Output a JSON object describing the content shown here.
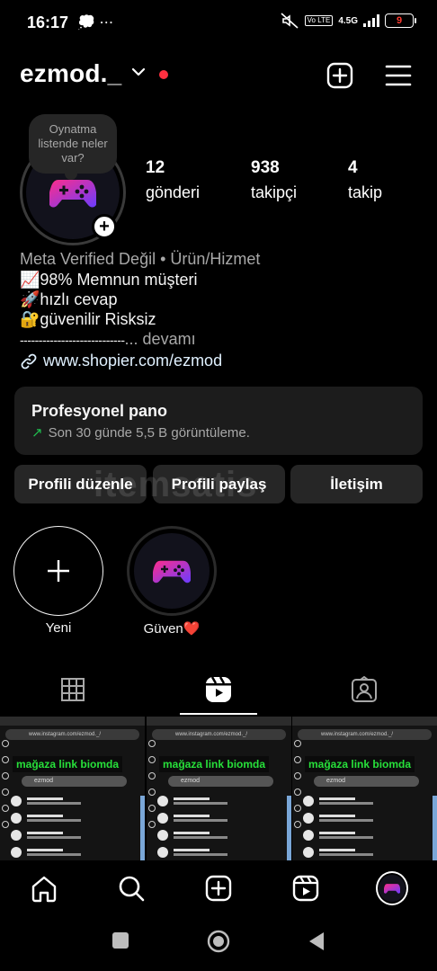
{
  "status_bar": {
    "time": "16:17",
    "left_icons": "💭 ⋯",
    "network": "4.5G",
    "lte_badge": "Vo LTE",
    "battery": "9"
  },
  "header": {
    "username": "ezmod._",
    "icons": [
      "chevron-down-icon",
      "new-post-icon",
      "menu-icon"
    ]
  },
  "profile": {
    "note": "Oynatma listende neler var?",
    "stats": [
      {
        "count": "12",
        "label": "gönderi"
      },
      {
        "count": "938",
        "label": "takipçi"
      },
      {
        "count": "4",
        "label": "takip"
      }
    ],
    "category": "Meta Verified Değil • Ürün/Hizmet",
    "bio_lines": [
      "📈98% Memnun müşteri",
      "🚀hızlı cevap",
      "🔐güvenilir Risksiz"
    ],
    "bio_more_line": "----------------------------",
    "bio_more": "... devamı",
    "link": "www.shopier.com/ezmod"
  },
  "pro_dashboard": {
    "title": "Profesyonel pano",
    "subtitle": "Son 30 günde 5,5 B görüntüleme."
  },
  "buttons": {
    "edit": "Profili düzenle",
    "share": "Profili paylaş",
    "contact": "İletişim"
  },
  "highlights": [
    {
      "label": "Yeni"
    },
    {
      "label": "Güven❤️"
    }
  ],
  "tabs": [
    "grid-icon",
    "reels-icon",
    "tagged-icon"
  ],
  "thumbnails": [
    {
      "url": "www.instagram.com/ezmod._/",
      "banner": "mağaza link biomda",
      "search": "ezmod"
    },
    {
      "url": "www.instagram.com/ezmod._/",
      "banner": "mağaza link biomda",
      "search": "ezmod"
    },
    {
      "url": "www.instagram.com/ezmod._/",
      "banner": "mağaza link biomda",
      "search": "ezmod"
    }
  ],
  "watermark": "itemsatis",
  "colors": {
    "background": "#000000",
    "card": "#1c1c1c",
    "button": "#262626",
    "accent_red": "#ff3040",
    "link": "#e0f1ff",
    "trend_green": "#1fbf4f",
    "banner_green": "#27e03a"
  }
}
